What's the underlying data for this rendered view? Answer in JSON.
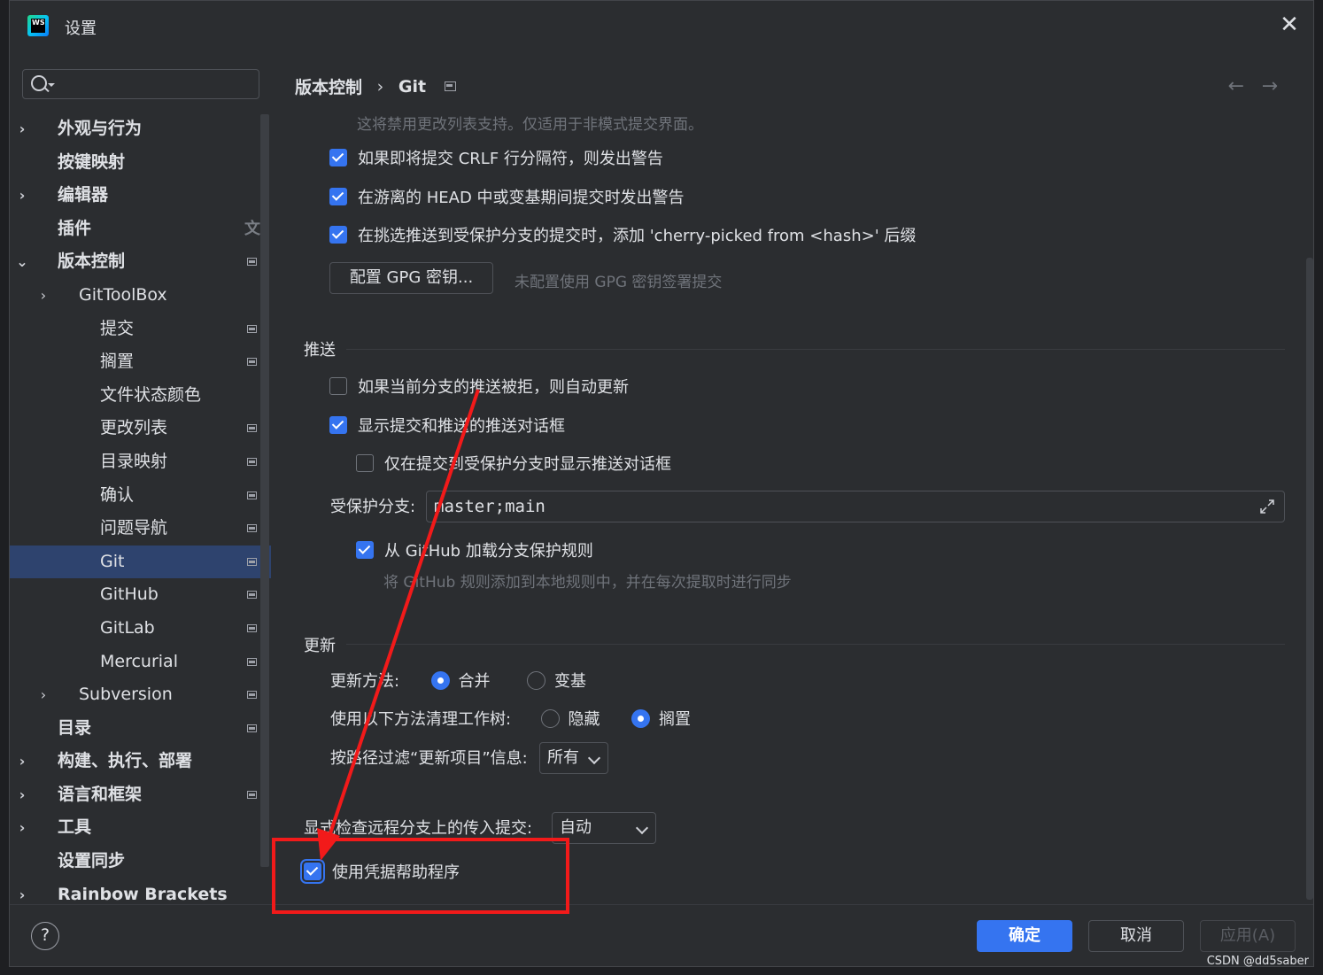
{
  "window": {
    "title": "设置"
  },
  "search": {
    "placeholder": ""
  },
  "sidebar": {
    "items": [
      {
        "label": "外观与行为",
        "level": 0,
        "chevron": "›",
        "bold": true,
        "pin": false
      },
      {
        "label": "按键映射",
        "level": 0,
        "chevron": "",
        "bold": true,
        "pin": false
      },
      {
        "label": "编辑器",
        "level": 0,
        "chevron": "›",
        "bold": true,
        "pin": false
      },
      {
        "label": "插件",
        "level": 0,
        "chevron": "",
        "bold": true,
        "pin": false,
        "translate": true
      },
      {
        "label": "版本控制",
        "level": 0,
        "chevron": "⌄",
        "bold": true,
        "pin": true
      },
      {
        "label": "GitToolBox",
        "level": 1,
        "chevron": "›",
        "bold": false,
        "pin": false
      },
      {
        "label": "提交",
        "level": 2,
        "chevron": "",
        "bold": false,
        "pin": true
      },
      {
        "label": "搁置",
        "level": 2,
        "chevron": "",
        "bold": false,
        "pin": true
      },
      {
        "label": "文件状态颜色",
        "level": 2,
        "chevron": "",
        "bold": false,
        "pin": false
      },
      {
        "label": "更改列表",
        "level": 2,
        "chevron": "",
        "bold": false,
        "pin": true
      },
      {
        "label": "目录映射",
        "level": 2,
        "chevron": "",
        "bold": false,
        "pin": true
      },
      {
        "label": "确认",
        "level": 2,
        "chevron": "",
        "bold": false,
        "pin": true
      },
      {
        "label": "问题导航",
        "level": 2,
        "chevron": "",
        "bold": false,
        "pin": true
      },
      {
        "label": "Git",
        "level": 2,
        "chevron": "",
        "bold": false,
        "pin": true,
        "selected": true
      },
      {
        "label": "GitHub",
        "level": 2,
        "chevron": "",
        "bold": false,
        "pin": true
      },
      {
        "label": "GitLab",
        "level": 2,
        "chevron": "",
        "bold": false,
        "pin": true
      },
      {
        "label": "Mercurial",
        "level": 2,
        "chevron": "",
        "bold": false,
        "pin": true
      },
      {
        "label": "Subversion",
        "level": 1,
        "chevron": "›",
        "bold": false,
        "pin": true
      },
      {
        "label": "目录",
        "level": 0,
        "chevron": "",
        "bold": true,
        "pin": true
      },
      {
        "label": "构建、执行、部署",
        "level": 0,
        "chevron": "›",
        "bold": true,
        "pin": false
      },
      {
        "label": "语言和框架",
        "level": 0,
        "chevron": "›",
        "bold": true,
        "pin": true
      },
      {
        "label": "工具",
        "level": 0,
        "chevron": "›",
        "bold": true,
        "pin": false
      },
      {
        "label": "设置同步",
        "level": 0,
        "chevron": "",
        "bold": true,
        "pin": false
      },
      {
        "label": "Rainbow Brackets",
        "level": 0,
        "chevron": "›",
        "bold": true,
        "pin": false
      }
    ]
  },
  "breadcrumb": {
    "parent": "版本控制",
    "separator": "›",
    "current": "Git"
  },
  "nav": {
    "back": "←",
    "forward": "→"
  },
  "content": {
    "top_hint": "这将禁用更改列表支持。仅适用于非模式提交界面。",
    "warn_crlf": "如果即将提交 CRLF 行分隔符，则发出警告",
    "warn_detached": "在游离的 HEAD 中或变基期间提交时发出警告",
    "cherry_pick": "在挑选推送到受保护分支的提交时，添加 'cherry-picked from <hash>' 后缀",
    "gpg_button": "配置 GPG 密钥...",
    "gpg_hint": "未配置使用 GPG 密钥签署提交",
    "push_section": "推送",
    "auto_update": "如果当前分支的推送被拒，则自动更新",
    "show_push_dialog": "显示提交和推送的推送对话框",
    "only_protected": "仅在提交到受保护分支时显示推送对话框",
    "protected_label": "受保护分支:",
    "protected_value": "master;main",
    "load_github_rules": "从 GitHub 加载分支保护规则",
    "github_rules_hint": "将 GitHub 规则添加到本地规则中，并在每次提取时进行同步",
    "update_section": "更新",
    "update_method_label": "更新方法:",
    "update_merge": "合并",
    "update_rebase": "变基",
    "clean_label": "使用以下方法清理工作树:",
    "clean_stash": "隐藏",
    "clean_shelve": "搁置",
    "filter_label": "按路径过滤“更新项目”信息:",
    "filter_value": "所有",
    "incoming_label": "显式检查远程分支上的传入提交:",
    "incoming_value": "自动",
    "credential_helper": "使用凭据帮助程序"
  },
  "footer": {
    "help": "?",
    "ok": "确定",
    "cancel": "取消",
    "apply": "应用(A)"
  },
  "watermark": "CSDN @dd5saber",
  "colors": {
    "accent": "#3574f0",
    "background": "#2b2d30",
    "selection": "#2e436e",
    "annotation": "#f21a1a"
  }
}
